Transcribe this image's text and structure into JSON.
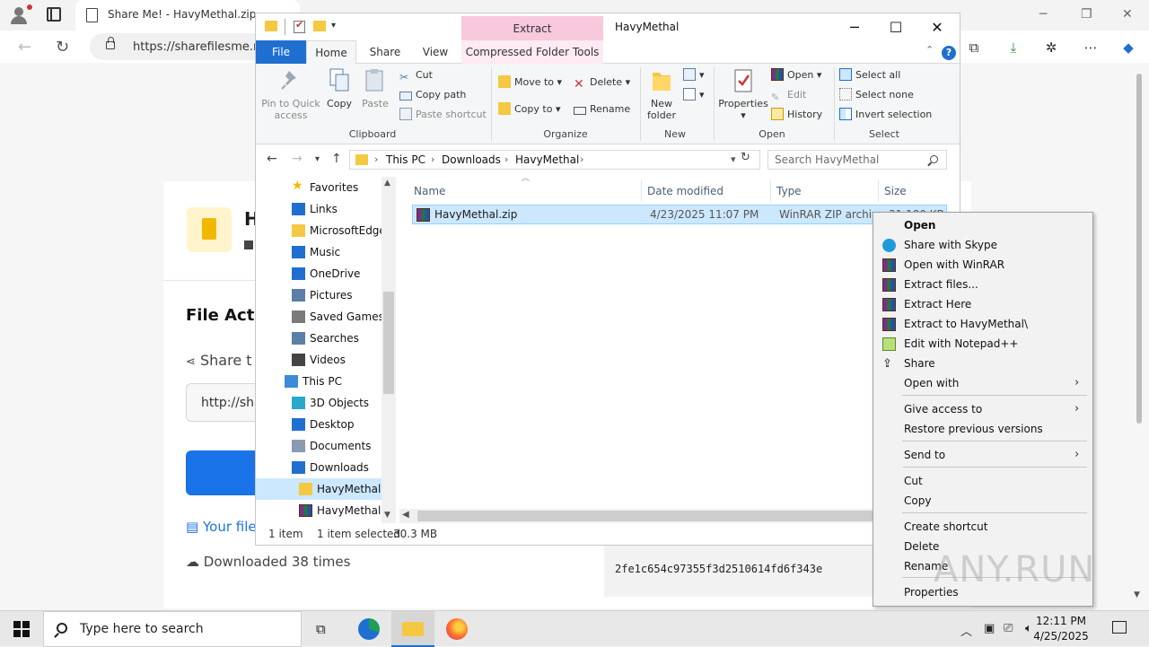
{
  "browser": {
    "tab_title": "Share Me! - HavyMethal.zip",
    "url": "https://sharefilesme.ne",
    "minimize": "─",
    "restore": "❐",
    "close": "✕"
  },
  "page": {
    "heading_fragment": "H",
    "file_actions": "File Actic",
    "share_label": "Share t",
    "share_input_value": "http://sha",
    "your_file": "Your file",
    "downloaded": "Downloaded 38 times",
    "hash": "2fe1c654c97355f3d2510614fd6f343e"
  },
  "explorer": {
    "extract_tab": "Extract",
    "title": "HavyMethal",
    "tabs": {
      "file": "File",
      "home": "Home",
      "share": "Share",
      "view": "View",
      "compressed": "Compressed Folder Tools"
    },
    "ribbon": {
      "clipboard": {
        "label": "Clipboard",
        "pin": "Pin to Quick access",
        "copy": "Copy",
        "paste": "Paste",
        "cut": "Cut",
        "copy_path": "Copy path",
        "paste_shortcut": "Paste shortcut"
      },
      "organize": {
        "label": "Organize",
        "move_to": "Move to",
        "copy_to": "Copy to",
        "delete": "Delete",
        "rename": "Rename"
      },
      "new": {
        "label": "New",
        "new_folder": "New folder"
      },
      "open": {
        "label": "Open",
        "properties": "Properties",
        "open": "Open",
        "edit": "Edit",
        "history": "History"
      },
      "select": {
        "label": "Select",
        "select_all": "Select all",
        "select_none": "Select none",
        "invert": "Invert selection"
      }
    },
    "address": {
      "crumbs": [
        "This PC",
        "Downloads",
        "HavyMethal"
      ],
      "search_placeholder": "Search HavyMethal"
    },
    "nav_items": [
      {
        "label": "Favorites",
        "icon": "star-icon"
      },
      {
        "label": "Links",
        "icon": "link-icon"
      },
      {
        "label": "MicrosoftEdge",
        "icon": "folder-icon"
      },
      {
        "label": "Music",
        "icon": "music-icon"
      },
      {
        "label": "OneDrive",
        "icon": "cloud-icon"
      },
      {
        "label": "Pictures",
        "icon": "pictures-icon"
      },
      {
        "label": "Saved Games",
        "icon": "games-icon"
      },
      {
        "label": "Searches",
        "icon": "search-icon"
      },
      {
        "label": "Videos",
        "icon": "videos-icon"
      },
      {
        "label": "This PC",
        "icon": "pc-icon"
      },
      {
        "label": "3D Objects",
        "icon": "cube-icon"
      },
      {
        "label": "Desktop",
        "icon": "desktop-icon"
      },
      {
        "label": "Documents",
        "icon": "documents-icon"
      },
      {
        "label": "Downloads",
        "icon": "download-icon"
      },
      {
        "label": "HavyMethal",
        "icon": "folder-icon"
      },
      {
        "label": "HavyMethal.z",
        "icon": "winrar-icon"
      }
    ],
    "columns": {
      "name": "Name",
      "date": "Date modified",
      "type": "Type",
      "size": "Size"
    },
    "file": {
      "name": "HavyMethal.zip",
      "date": "4/23/2025 11:07 PM",
      "type": "WinRAR ZIP archive",
      "size": "31,180 KB"
    },
    "status": {
      "items": "1 item",
      "selected": "1 item selected",
      "size": "30.3 MB"
    }
  },
  "context_menu": {
    "items": [
      {
        "label": "Open"
      },
      {
        "label": "Share with Skype"
      },
      {
        "label": "Open with WinRAR"
      },
      {
        "label": "Extract files..."
      },
      {
        "label": "Extract Here"
      },
      {
        "label": "Extract to HavyMethal\\"
      },
      {
        "label": "Edit with Notepad++"
      },
      {
        "label": "Share"
      },
      {
        "label": "Open with"
      },
      {
        "label": "Give access to"
      },
      {
        "label": "Restore previous versions"
      },
      {
        "label": "Send to"
      },
      {
        "label": "Cut"
      },
      {
        "label": "Copy"
      },
      {
        "label": "Create shortcut"
      },
      {
        "label": "Delete"
      },
      {
        "label": "Rename"
      },
      {
        "label": "Properties"
      }
    ]
  },
  "watermark": "ANY.RUN",
  "taskbar": {
    "search_placeholder": "Type here to search",
    "time": "12:11 PM",
    "date": "4/25/2025"
  },
  "colors": {
    "accent": "#1f6fd0",
    "selection": "#cce8ff",
    "extract_tab": "#f8c8dc"
  }
}
